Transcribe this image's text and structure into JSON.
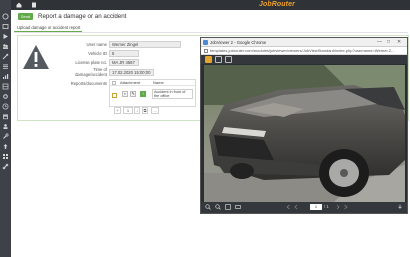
{
  "app": {
    "name": "JobRouter"
  },
  "topbar": {
    "icons": [
      "home-icon",
      "document-icon"
    ]
  },
  "rail": {
    "icons": [
      "workflow-icon",
      "inbox-icon",
      "start-icon",
      "group-icon",
      "tools-icon",
      "list-icon",
      "chart-icon",
      "table-icon",
      "settings-icon",
      "clock-icon",
      "archive-icon",
      "user-icon",
      "wrench-icon",
      "upload-icon",
      "grid-icon",
      "link-icon",
      "pin-icon"
    ]
  },
  "header": {
    "send_label": "Send",
    "title": "Report a damage or an accident",
    "favorite_icon": "star-icon"
  },
  "tabs": [
    {
      "label": "Upload damage or accident report"
    }
  ],
  "form": {
    "user_name_label": "User name",
    "user_name_value": "Werner Zingel",
    "vehicle_id_label": "Vehicle ID",
    "vehicle_id_value": "5",
    "license_plate_label": "License plate no.",
    "license_plate_value": "MA JR 4567",
    "time_label_1": "Time of",
    "time_label_2": "damage/accident",
    "time_value": "17.02.2020 15:00:00",
    "reports_label": "Reports/documents"
  },
  "attachments": {
    "col_attachment": "Attachment",
    "col_name": "Name",
    "rows": [
      {
        "name": "Accident in front of the office"
      }
    ],
    "pager": {
      "add": "+",
      "page": "1",
      "down": "↓",
      "copy": "⧉",
      "more": "..."
    }
  },
  "viewer": {
    "title": "JobViewer 2 - Google Chrome",
    "url": "templates.jobrouter.com/modules/jobviewer/viewers/JobViewStandard/index.php?username=Werner.Z...",
    "window_controls": [
      "—",
      "□",
      "✕"
    ],
    "page_label": "1",
    "page_total": "/ 1",
    "image": "photo of a dark grey car with a crashed front end"
  },
  "colors": {
    "accent": "#61a94b",
    "logo": "#f0a12a",
    "rail": "#3e4147",
    "topbar": "#2f3237"
  }
}
